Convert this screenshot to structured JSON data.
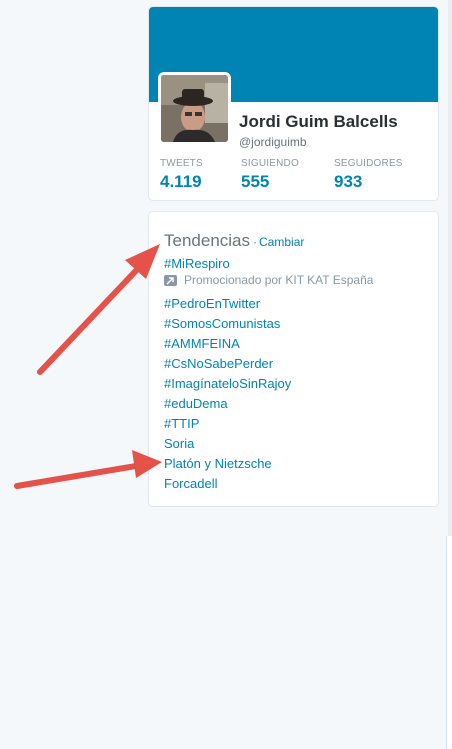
{
  "profile": {
    "name": "Jordi Guim Balcells",
    "handle": "@jordiguimb",
    "stats": [
      {
        "label": "TWEETS",
        "value": "4.119"
      },
      {
        "label": "SIGUIENDO",
        "value": "555"
      },
      {
        "label": "SEGUIDORES",
        "value": "933"
      }
    ],
    "banner_color": "#0084b4"
  },
  "trends": {
    "title": "Tendencias",
    "separator": "·",
    "change_label": "Cambiar",
    "promoted": {
      "tag": "#MiRespiro",
      "label": "Promocionado por KIT KAT España"
    },
    "items": [
      "#PedroEnTwitter",
      "#SomosComunistas",
      "#AMMFEINA",
      "#CsNoSabePerder",
      "#ImagínateloSinRajoy",
      "#eduDema",
      "#TTIP",
      "Soria",
      "Platón y Nietzsche",
      "Forcadell"
    ]
  },
  "colors": {
    "link": "#0084b4",
    "annotation_arrow": "#e4524a"
  },
  "icons": {
    "promoted": "promoted-arrow-icon"
  }
}
